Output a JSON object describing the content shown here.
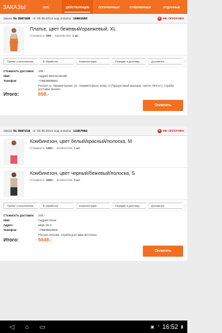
{
  "app": {
    "title": "ЗАКАЗЫ"
  },
  "tabs": [
    {
      "label": "Все"
    },
    {
      "label": "Действующие"
    },
    {
      "label": "Оплаченные"
    },
    {
      "label": "Отменённые"
    },
    {
      "label": "Отданные"
    }
  ],
  "orders": [
    {
      "header": {
        "order_label": "Заказ",
        "order_no": "№ 3587468",
        "date": "от 30.06.2014",
        "code_label": "код оплаты:",
        "code": "16661550"
      },
      "status": "НЕ ОПЛАЧЕН",
      "items": [
        {
          "title": "Платье, цвет бежевый/оранжевый, XL",
          "price_label": "Стоимость:",
          "price": "699.-",
          "qty_label": "Количество:",
          "qty": "1 шт."
        }
      ],
      "steps": [
        "Принят к исполнению",
        "В обработке",
        "Комплектация",
        "Передан в доставку",
        "Доставлен"
      ],
      "delivery_label": "Стоимость доставки:",
      "delivery": "199.-",
      "name_label": "Имя:",
      "name": "Андрей Миспловский",
      "phone_label": "Телефон:",
      "phone": "+79809888884",
      "address": "Россия, м. Авиамоторная, ул. Авиамоторная, влад. 4 (Продуктовый магазин, салон «Фото»), служба доставки Бизнес",
      "total_label": "Итого:",
      "total": "898.-",
      "pay": "Оплатить"
    },
    {
      "header": {
        "order_label": "Заказ",
        "order_no": "№ 3587218",
        "date": "от 30.06.2014",
        "code_label": "код оплаты:",
        "code": "12467984"
      },
      "status": "НЕ ОПЛАЧЕН",
      "items": [
        {
          "title": "Комбинезон, цвет белый/красный/полоска, M",
          "price_label": "Стоимость:",
          "price": "1800.-",
          "qty_label": "Количество:",
          "qty": "1 шт."
        },
        {
          "title": "Комбинезон, цвет черный/бежевый/полоска, S",
          "price_label": "Стоимость:",
          "price": "3600.-",
          "qty_label": "Количество:",
          "qty": "2 шт."
        }
      ],
      "steps": [
        "Принят к исполнению",
        "В обработке",
        "Комплектация",
        "Передан в доставку",
        "Доставлен"
      ],
      "delivery_label": "Стоимость доставки:",
      "delivery": "249.-",
      "name_label": "Имя:",
      "name": "Андрей Олан",
      "address_label": "Адрес:",
      "address_line": "мкра 16-4",
      "phone_label": "Телефон:",
      "phone": "+79809553500",
      "address": "Россия, Москва, служба доставки Беттенон",
      "total_label": "Итого:",
      "total": "5649.-",
      "pay": "Оплатить"
    }
  ],
  "status_bar": {
    "time": "16:52"
  },
  "colors": {
    "accent": "#f36f21",
    "unpaid": "#d9251b",
    "nav": "#000000"
  }
}
